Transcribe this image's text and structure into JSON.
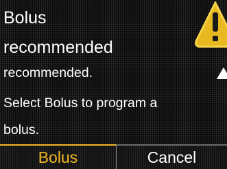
{
  "message": {
    "title_lines": [
      "Bolus",
      "recommended"
    ],
    "body_lines": [
      "recommended.",
      "Select Bolus to program a",
      "bolus."
    ]
  },
  "icons": {
    "warning": "warning-triangle-icon",
    "scroll": "scroll-up-arrow-icon"
  },
  "softkeys": {
    "left_label": "Bolus",
    "right_label": "Cancel"
  },
  "colors": {
    "selected_softkey": "#f2b624",
    "text": "#ffffff",
    "background": "#0a0a0a",
    "warning_yellow": "#e8b820"
  }
}
